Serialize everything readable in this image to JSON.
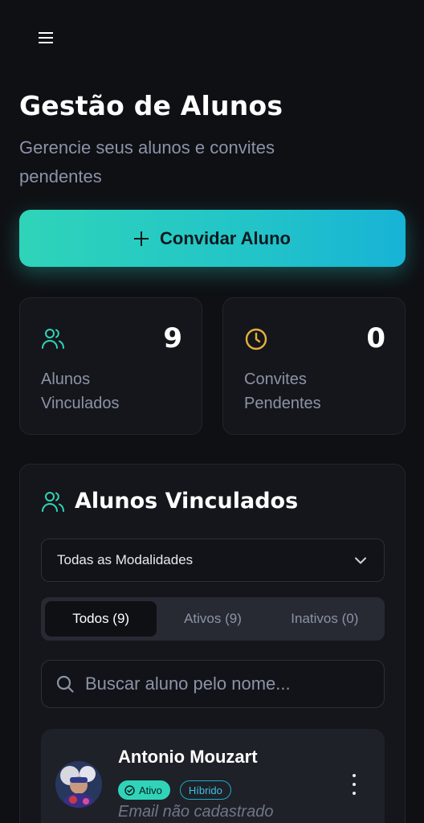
{
  "page": {
    "title": "Gestão de Alunos",
    "subtitle": "Gerencie seus alunos e convites pendentes"
  },
  "actions": {
    "invite_label": "Convidar Aluno"
  },
  "stats": [
    {
      "value": "9",
      "label": "Alunos Vinculados",
      "icon": "users-icon"
    },
    {
      "value": "0",
      "label": "Convites Pendentes",
      "icon": "clock-icon"
    }
  ],
  "list": {
    "title": "Alunos Vinculados",
    "filter_selected": "Todas as Modalidades",
    "tabs": [
      "Todos (9)",
      "Ativos (9)",
      "Inativos (0)"
    ],
    "active_tab": "Todos (9)",
    "search_placeholder": "Buscar aluno pelo nome...",
    "students": [
      {
        "name": "Antonio Mouzart",
        "status": "Ativo",
        "mode": "Híbrido",
        "email": "Email não cadastrado"
      }
    ]
  },
  "colors": {
    "background": "#0f1014",
    "accent": "#2fd4b8",
    "accent_blue": "#18b3d6",
    "pending": "#e3b23c",
    "muted_text": "#8b93a6"
  }
}
